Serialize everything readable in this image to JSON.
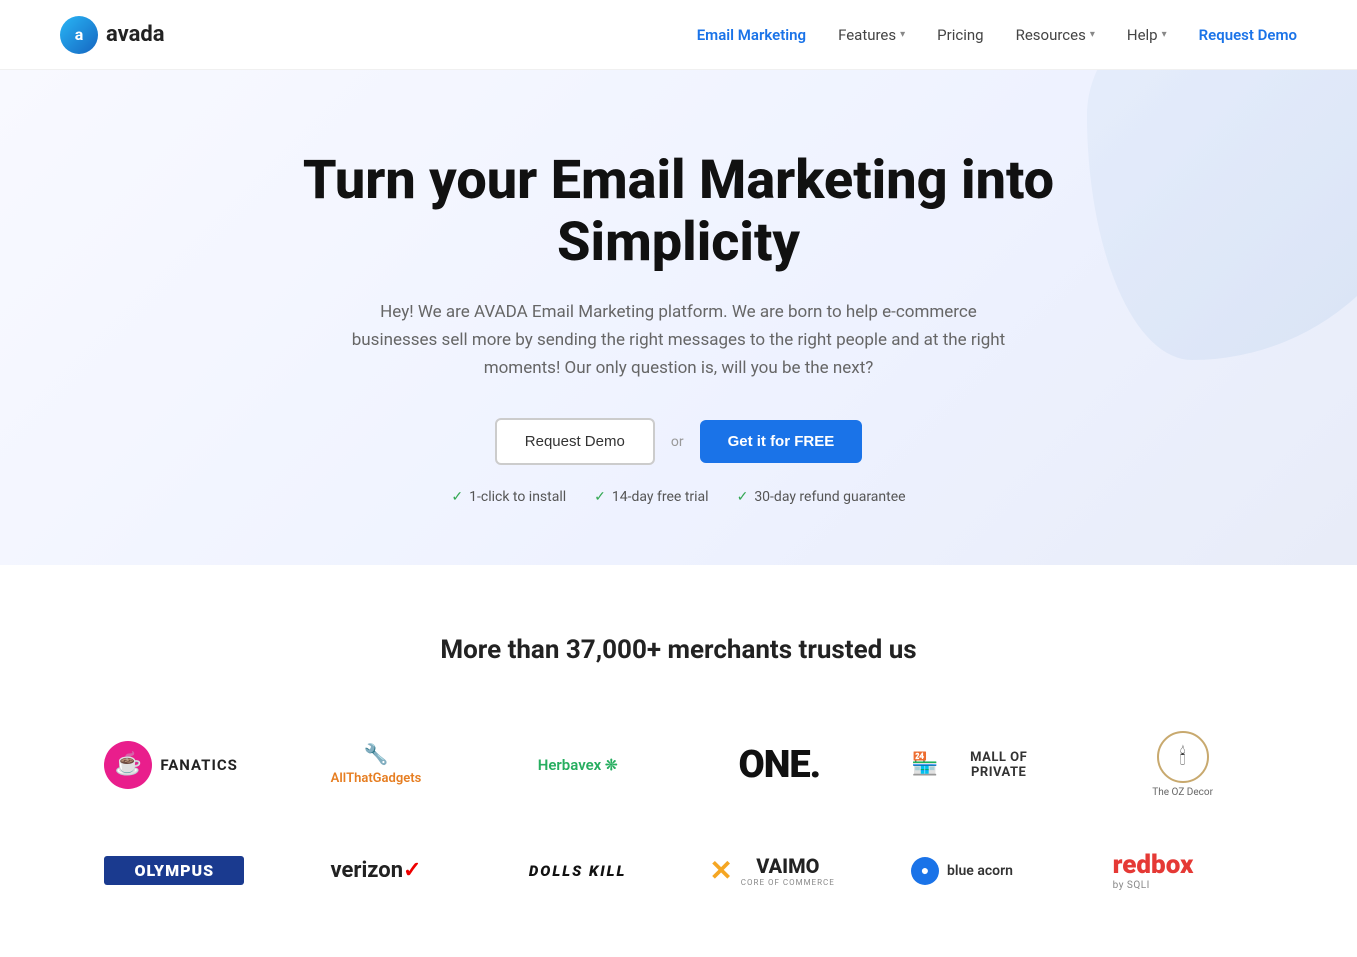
{
  "brand": {
    "logo_letter": "a",
    "name": "avada"
  },
  "nav": {
    "links": [
      {
        "id": "email-marketing",
        "label": "Email Marketing",
        "active": true,
        "has_dropdown": false
      },
      {
        "id": "features",
        "label": "Features",
        "active": false,
        "has_dropdown": true
      },
      {
        "id": "pricing",
        "label": "Pricing",
        "active": false,
        "has_dropdown": false
      },
      {
        "id": "resources",
        "label": "Resources",
        "active": false,
        "has_dropdown": true
      },
      {
        "id": "help",
        "label": "Help",
        "active": false,
        "has_dropdown": true
      },
      {
        "id": "request-demo",
        "label": "Request Demo",
        "active": false,
        "has_dropdown": false,
        "is_cta": true
      }
    ]
  },
  "hero": {
    "heading": "Turn your Email Marketing into Simplicity",
    "subtext": "Hey! We are AVADA Email Marketing platform. We are born to help e-commerce businesses sell more by sending the right messages to the right people and at the right moments! Our only question is, will you be the next?",
    "btn_demo": "Request Demo",
    "or_text": "or",
    "btn_free": "Get it for FREE",
    "badges": [
      {
        "id": "install",
        "text": "1-click to install"
      },
      {
        "id": "trial",
        "text": "14-day free trial"
      },
      {
        "id": "refund",
        "text": "30-day refund guarantee"
      }
    ]
  },
  "trusted": {
    "heading": "More than 37,000+ merchants trusted us",
    "logos_row1": [
      {
        "id": "fanatics",
        "name": "Fanatics",
        "type": "fanatics"
      },
      {
        "id": "allthatgadgets",
        "name": "AllThatGadgets",
        "type": "allthat"
      },
      {
        "id": "herbavex",
        "name": "Herbavex",
        "type": "herbavex"
      },
      {
        "id": "one",
        "name": "ONE.",
        "type": "one"
      },
      {
        "id": "mallofprivate",
        "name": "Mall of Private",
        "type": "mallofprivate"
      },
      {
        "id": "ozdecor",
        "name": "The OZ Decor",
        "type": "ozdecor"
      }
    ],
    "logos_row2": [
      {
        "id": "olympus",
        "name": "OLYMPUS",
        "type": "olympus"
      },
      {
        "id": "verizon",
        "name": "verizon",
        "type": "verizon"
      },
      {
        "id": "dollskill",
        "name": "DOLLS KILL",
        "type": "dollskill"
      },
      {
        "id": "vaimo",
        "name": "VAIMO",
        "type": "vaimo"
      },
      {
        "id": "blueacorn",
        "name": "blue acorn",
        "type": "blueacorn"
      },
      {
        "id": "redbox",
        "name": "redbox",
        "type": "redbox"
      }
    ]
  }
}
